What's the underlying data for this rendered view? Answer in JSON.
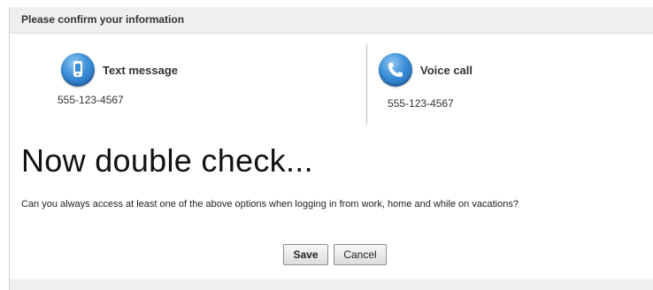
{
  "header": {
    "title": "Please confirm your information"
  },
  "options": {
    "text_message": {
      "label": "Text message",
      "number": "555-123-4567",
      "icon": "mobile-phone-icon"
    },
    "voice_call": {
      "label": "Voice call",
      "number": "555-123-4567",
      "icon": "phone-handset-icon"
    }
  },
  "confirm": {
    "headline": "Now double check...",
    "question": "Can you always access at least one of the above options when logging in from work, home and while on vacations?"
  },
  "actions": {
    "save_label": "Save",
    "cancel_label": "Cancel"
  },
  "colors": {
    "icon_blue": "#3a8ed8",
    "header_bg": "#efefef"
  }
}
